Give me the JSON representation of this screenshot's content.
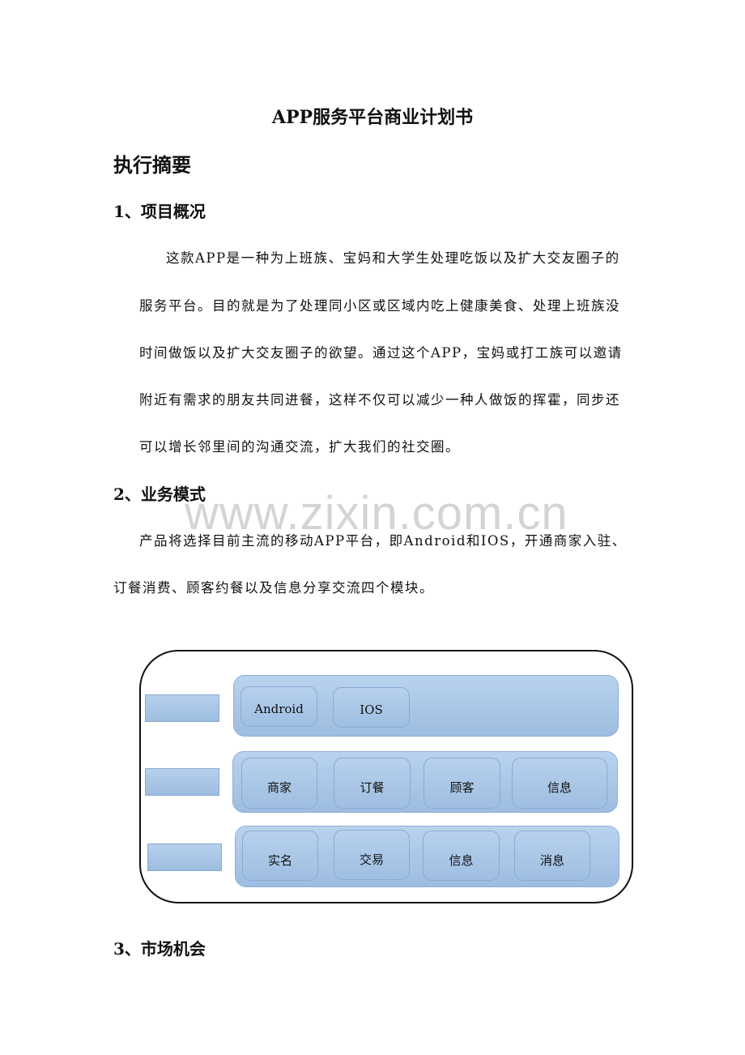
{
  "title": "APP服务平台商业计划书",
  "section": "执行摘要",
  "headings": [
    "1、项目概况",
    "2、业务模式",
    "3、市场机会"
  ],
  "overview_lines": [
    "这款APP是一种为上班族、宝妈和大学生处理吃饭以及扩大交友圈子的",
    "服务平台。目的就是为了处理同小区或区域内吃上健康美食、处理上班族没",
    "时间做饭以及扩大交友圈子的欲望。通过这个APP，宝妈或打工族可以邀请",
    "附近有需求的朋友共同进餐，这样不仅可以减少一种人做饭的挥霍，同步还",
    "可以增长邻里间的沟通交流，扩大我们的社交圈。"
  ],
  "business_lines": [
    "产品将选择目前主流的移动APP平台，即Android和IOS，开通商家入驻、",
    "订餐消费、顾客约餐以及信息分享交流四个模块。"
  ],
  "watermark": "www.zixin.com.cn",
  "diagram": {
    "row1": [
      "Android",
      "IOS"
    ],
    "row2": [
      "商家",
      "订餐",
      "顾客",
      "信息"
    ],
    "row3": [
      "实名",
      "交易",
      "信息",
      "消息"
    ],
    "fill_color": "#a9c6e7",
    "border_color": "#8aaad2"
  }
}
